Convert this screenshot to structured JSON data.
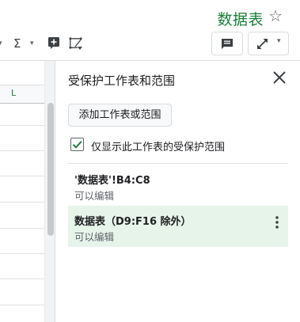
{
  "header": {
    "title": "数据表",
    "star_icon": "☆"
  },
  "toolbar": {
    "sigma_label": "Σ",
    "caret": "▾"
  },
  "grid": {
    "column_letter": "L"
  },
  "panel": {
    "title": "受保护工作表和范围",
    "add_button_label": "添加工作表或范围",
    "checkbox_label": "仅显示此工作表的受保护范围",
    "checkbox_checked": true,
    "ranges": [
      {
        "name": "'数据表'!B4:C8",
        "description": "可以编辑",
        "selected": false
      },
      {
        "name": "数据表（D9:F16 除外）",
        "description": "可以编辑",
        "selected": true
      }
    ]
  },
  "colors": {
    "title_green": "#188038",
    "selected_bg": "#e6f4ea",
    "check_green": "#188038"
  }
}
